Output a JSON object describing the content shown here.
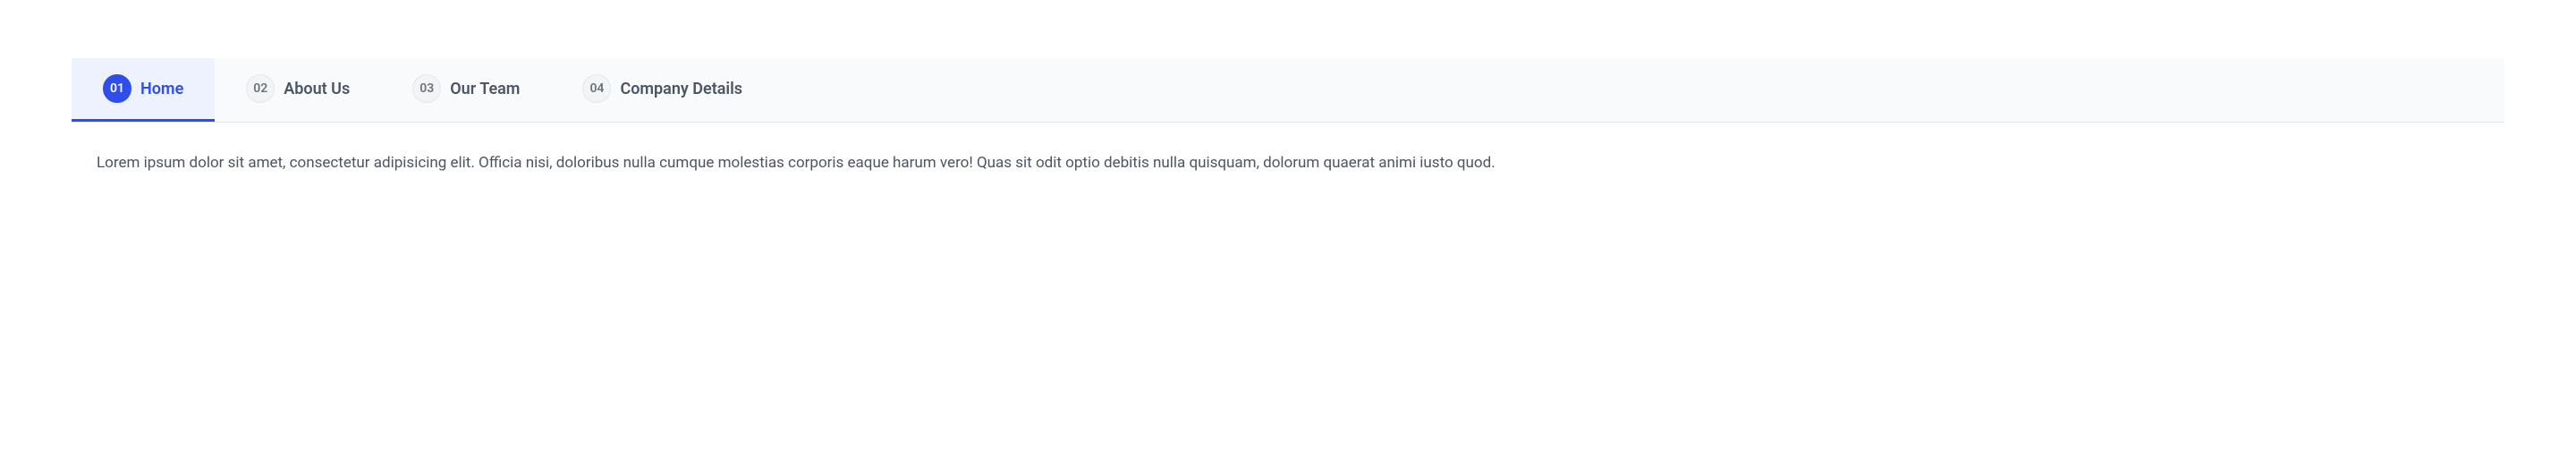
{
  "tabs": [
    {
      "number": "01",
      "label": "Home",
      "active": true
    },
    {
      "number": "02",
      "label": "About Us",
      "active": false
    },
    {
      "number": "03",
      "label": "Our Team",
      "active": false
    },
    {
      "number": "04",
      "label": "Company Details",
      "active": false
    }
  ],
  "content": {
    "text": "Lorem ipsum dolor sit amet, consectetur adipisicing elit. Officia nisi, doloribus nulla cumque molestias corporis eaque harum vero! Quas sit odit optio debitis nulla quisquam, dolorum quaerat animi iusto quod."
  }
}
